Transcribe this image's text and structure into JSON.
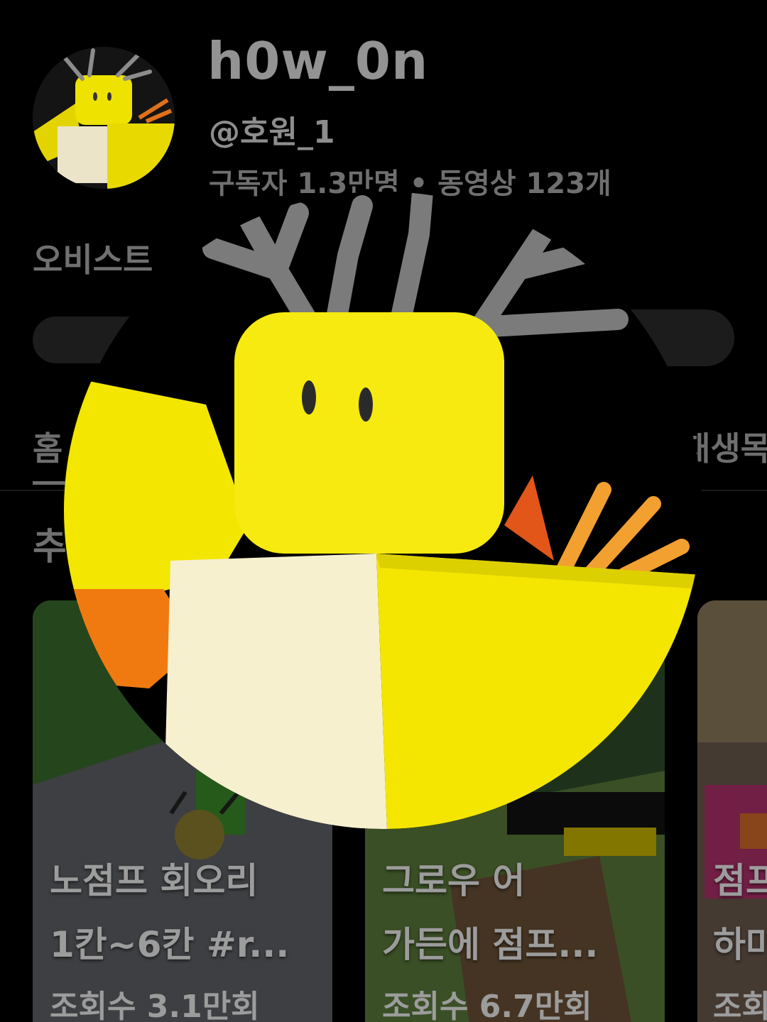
{
  "channel": {
    "name": "h0w_0n",
    "handle": "@호원_1",
    "stats": "구독자 1.3만명 • 동영상 123개",
    "description": "오비스트"
  },
  "tabs": {
    "home": "홈",
    "playlists": "재생목록"
  },
  "section": {
    "title": "추천"
  },
  "shorts": [
    {
      "title": "노점프 회오리\n1칸~6칸  #r...",
      "views": "조회수 3.1만회"
    },
    {
      "title": "그로우 어\n가든에 점프...",
      "views": "조회수 6.7만회"
    },
    {
      "title": "점프\n하마",
      "views": "조회수"
    }
  ],
  "colors": {
    "background": "#000000",
    "avatar_yellow": "#f2e200",
    "antler_gray": "#6f6f6f"
  },
  "icons": {
    "profile_picture": "roblox-yellow-character-with-antlers"
  }
}
